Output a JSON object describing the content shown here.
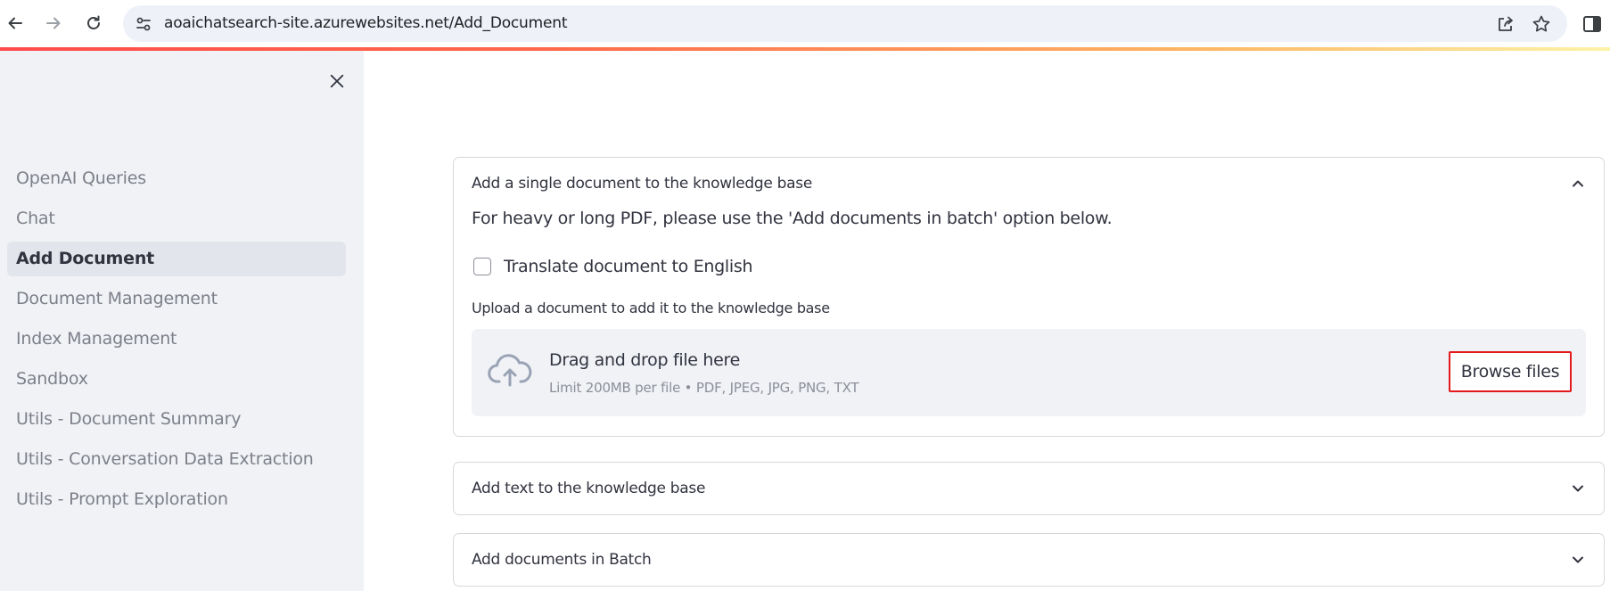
{
  "browser": {
    "url": "aoaichatsearch-site.azurewebsites.net/Add_Document"
  },
  "sidebar": {
    "items": [
      {
        "label": "OpenAI Queries"
      },
      {
        "label": "Chat"
      },
      {
        "label": "Add Document",
        "active": true
      },
      {
        "label": "Document Management"
      },
      {
        "label": "Index Management"
      },
      {
        "label": "Sandbox"
      },
      {
        "label": "Utils - Document Summary"
      },
      {
        "label": "Utils - Conversation Data Extraction"
      },
      {
        "label": "Utils - Prompt Exploration"
      }
    ]
  },
  "main": {
    "single_doc": {
      "title": "Add a single document to the knowledge base",
      "info": "For heavy or long PDF, please use the 'Add documents in batch' option below.",
      "translate_label": "Translate document to English",
      "translate_checked": false,
      "upload_label": "Upload a document to add it to the knowledge base",
      "dropzone_title": "Drag and drop file here",
      "dropzone_limit": "Limit 200MB per file • PDF, JPEG, JPG, PNG, TXT",
      "browse_label": "Browse files"
    },
    "add_text": {
      "title": "Add text to the knowledge base"
    },
    "batch": {
      "title": "Add documents in Batch"
    }
  },
  "colors": {
    "accent": "#ff4b4b",
    "highlight_border": "#e3191c",
    "sidebar_bg": "#f0f2f6"
  }
}
